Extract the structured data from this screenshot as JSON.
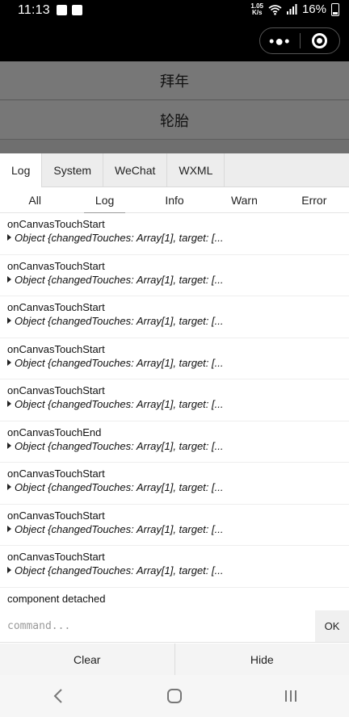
{
  "status_bar": {
    "time": "11:13",
    "net_speed_top": "1.05",
    "net_speed_bottom": "K/s",
    "battery": "16%"
  },
  "page": {
    "buttons": [
      "拜年",
      "轮胎"
    ]
  },
  "vconsole": {
    "tabs": [
      {
        "label": "Log",
        "active": true
      },
      {
        "label": "System",
        "active": false
      },
      {
        "label": "WeChat",
        "active": false
      },
      {
        "label": "WXML",
        "active": false
      }
    ],
    "subtabs": [
      {
        "label": "All",
        "active": false
      },
      {
        "label": "Log",
        "active": true
      },
      {
        "label": "Info",
        "active": false
      },
      {
        "label": "Warn",
        "active": false
      },
      {
        "label": "Error",
        "active": false
      }
    ],
    "logs": [
      {
        "title": "onCanvasTouchStart",
        "object": "Object {changedTouches: Array[1], target: [..."
      },
      {
        "title": "onCanvasTouchStart",
        "object": "Object {changedTouches: Array[1], target: [..."
      },
      {
        "title": "onCanvasTouchStart",
        "object": "Object {changedTouches: Array[1], target: [..."
      },
      {
        "title": "onCanvasTouchStart",
        "object": "Object {changedTouches: Array[1], target: [..."
      },
      {
        "title": "onCanvasTouchStart",
        "object": "Object {changedTouches: Array[1], target: [..."
      },
      {
        "title": "onCanvasTouchEnd",
        "object": "Object {changedTouches: Array[1], target: [..."
      },
      {
        "title": "onCanvasTouchStart",
        "object": "Object {changedTouches: Array[1], target: [..."
      },
      {
        "title": "onCanvasTouchStart",
        "object": "Object {changedTouches: Array[1], target: [..."
      },
      {
        "title": "onCanvasTouchStart",
        "object": "Object {changedTouches: Array[1], target: [..."
      }
    ],
    "last_log": "component detached",
    "command_placeholder": "command...",
    "ok_label": "OK",
    "clear_label": "Clear",
    "hide_label": "Hide"
  },
  "colors": {
    "status_bar_bg": "#000000",
    "dim_overlay": "#6f6f6f",
    "tab_bg": "#ededed"
  },
  "icons": [
    "back-icon",
    "home-icon",
    "recents-icon",
    "more-icon",
    "target-icon",
    "wifi-icon",
    "signal-icon",
    "battery-icon"
  ]
}
